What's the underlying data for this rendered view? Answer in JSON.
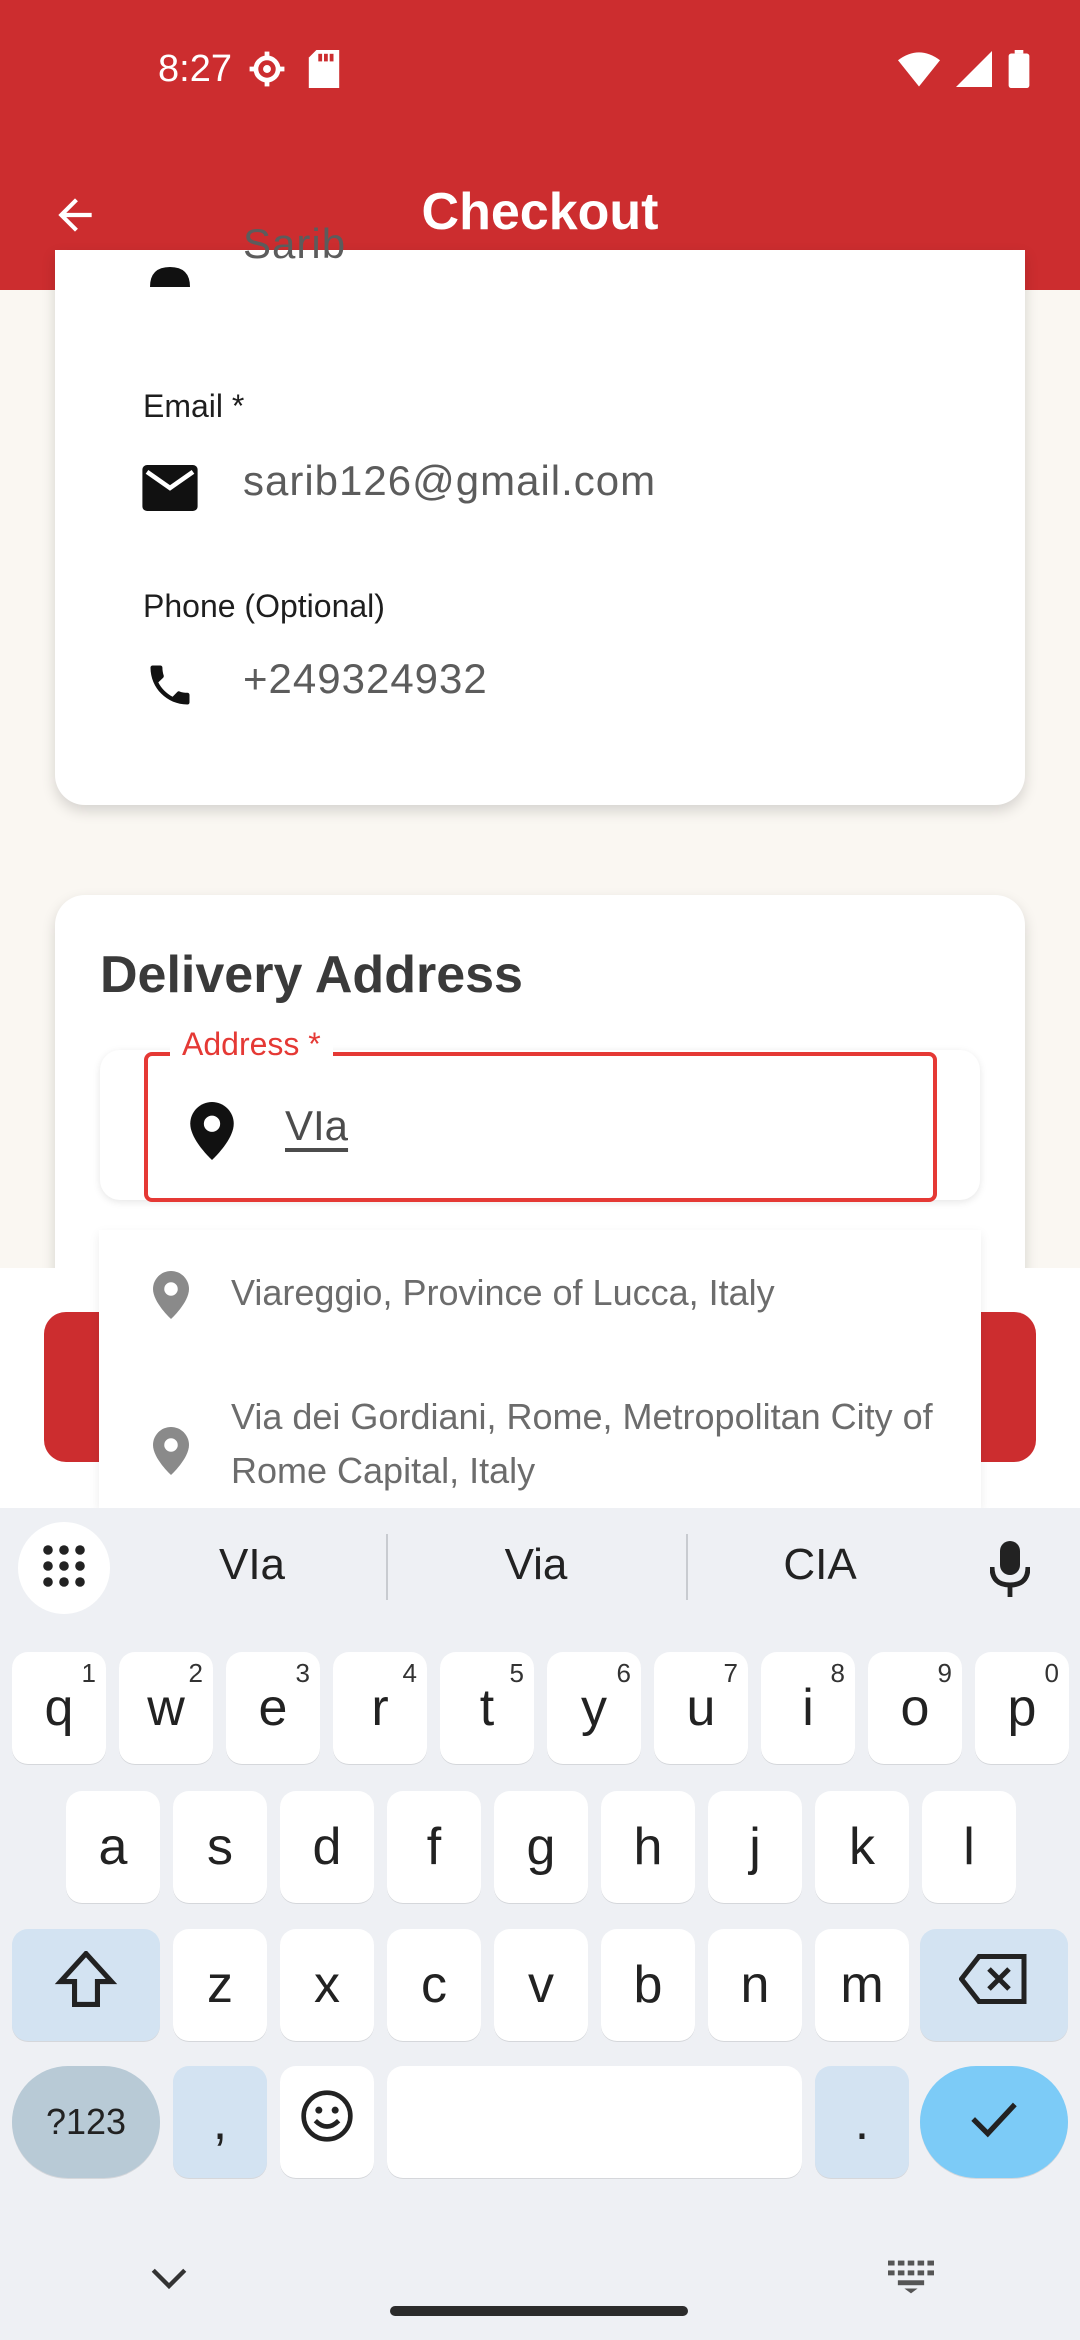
{
  "status_bar": {
    "time": "8:27",
    "icons": [
      "gear-icon",
      "sd-card-icon",
      "wifi-icon",
      "cellular-signal-icon",
      "battery-icon"
    ]
  },
  "app_bar": {
    "title": "Checkout",
    "back_icon": "arrow-back-icon",
    "color": "#cc2d2f"
  },
  "contact": {
    "name_value": "Sarib",
    "email_label": "Email *",
    "email_value": "sarib126@gmail.com",
    "phone_label": "Phone (Optional)",
    "phone_value": "+249324932"
  },
  "delivery": {
    "section_title": "Delivery Address",
    "address_label": "Address *",
    "address_value": "VIa",
    "accent": "#e53935"
  },
  "suggestions": [
    {
      "text": "Viareggio, Province of Lucca, Italy",
      "icon": "place-icon"
    },
    {
      "text": "Via dei Gordiani, Rome, Metropolitan City of Rome Capital, Italy",
      "icon": "place-icon"
    }
  ],
  "keyboard": {
    "suggestions": [
      "VIa",
      "Via",
      "CIA"
    ],
    "row1": [
      {
        "k": "q",
        "h": "1"
      },
      {
        "k": "w",
        "h": "2"
      },
      {
        "k": "e",
        "h": "3"
      },
      {
        "k": "r",
        "h": "4"
      },
      {
        "k": "t",
        "h": "5"
      },
      {
        "k": "y",
        "h": "6"
      },
      {
        "k": "u",
        "h": "7"
      },
      {
        "k": "i",
        "h": "8"
      },
      {
        "k": "o",
        "h": "9"
      },
      {
        "k": "p",
        "h": "0"
      }
    ],
    "row2": [
      "a",
      "s",
      "d",
      "f",
      "g",
      "h",
      "j",
      "k",
      "l"
    ],
    "row3": [
      "z",
      "x",
      "c",
      "v",
      "b",
      "n",
      "m"
    ],
    "sym_label": "?123",
    "comma": ",",
    "period": ".",
    "enter_color": "#7ccbf7"
  }
}
